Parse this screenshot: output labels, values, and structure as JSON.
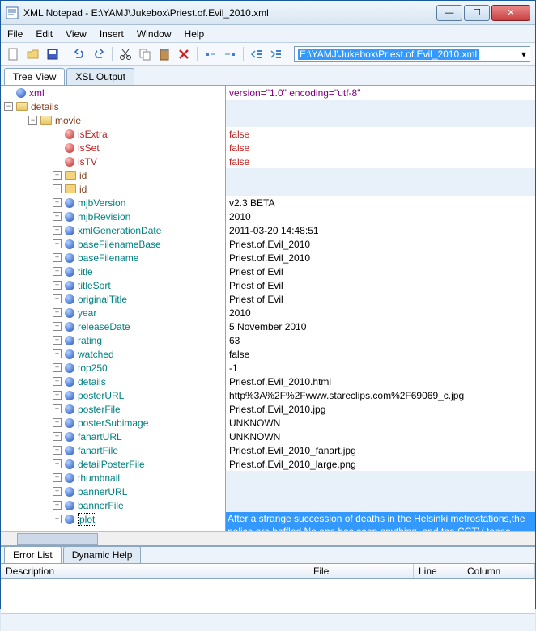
{
  "window": {
    "title": "XML Notepad - E:\\YAMJ\\Jukebox\\Priest.of.Evil_2010.xml"
  },
  "menu": {
    "file": "File",
    "edit": "Edit",
    "view": "View",
    "insert": "Insert",
    "window": "Window",
    "help": "Help"
  },
  "address": {
    "path": "E:\\YAMJ\\Jukebox\\Priest.of.Evil_2010.xml"
  },
  "tabs": {
    "tree": "Tree View",
    "xsl": "XSL Output"
  },
  "tree": {
    "xml": "xml",
    "details": "details",
    "movie": "movie",
    "nodes": {
      "isExtra": "isExtra",
      "isSet": "isSet",
      "isTV": "isTV",
      "id1": "id",
      "id2": "id",
      "mjbVersion": "mjbVersion",
      "mjbRevision": "mjbRevision",
      "xmlGenerationDate": "xmlGenerationDate",
      "baseFilenameBase": "baseFilenameBase",
      "baseFilename": "baseFilename",
      "title": "title",
      "titleSort": "titleSort",
      "originalTitle": "originalTitle",
      "year": "year",
      "releaseDate": "releaseDate",
      "rating": "rating",
      "watched": "watched",
      "top250": "top250",
      "details": "details",
      "posterURL": "posterURL",
      "posterFile": "posterFile",
      "posterSubimage": "posterSubimage",
      "fanartURL": "fanartURL",
      "fanartFile": "fanartFile",
      "detailPosterFile": "detailPosterFile",
      "thumbnail": "thumbnail",
      "bannerURL": "bannerURL",
      "bannerFile": "bannerFile",
      "plot": "plot"
    }
  },
  "values": {
    "xml": "version=\"1.0\" encoding=\"utf-8\"",
    "isExtra": "false",
    "isSet": "false",
    "isTV": "false",
    "mjbVersion": "v2.3 BETA",
    "mjbRevision": "2010",
    "xmlGenerationDate": "2011-03-20 14:48:51",
    "baseFilenameBase": "Priest.of.Evil_2010",
    "baseFilename": "Priest.of.Evil_2010",
    "title": "Priest of Evil",
    "titleSort": "Priest of Evil",
    "originalTitle": "Priest of Evil",
    "year": "2010",
    "releaseDate": "5 November 2010",
    "rating": "63",
    "watched": "false",
    "top250": "-1",
    "details": "Priest.of.Evil_2010.html",
    "posterURL": "http%3A%2F%2Fwww.stareclips.com%2F69069_c.jpg",
    "posterFile": "Priest.of.Evil_2010.jpg",
    "posterSubimage": "UNKNOWN",
    "fanartURL": "UNKNOWN",
    "fanartFile": "Priest.of.Evil_2010_fanart.jpg",
    "detailPosterFile": "Priest.of.Evil_2010_large.png",
    "plot": "After a strange succession of deaths in the Helsinki metrostations,the police are baffled.No one has seen anything, and the CCTV tapes show nothing. Audio Finnish with English Subtitles."
  },
  "bottomTabs": {
    "errors": "Error List",
    "help": "Dynamic Help"
  },
  "grid": {
    "desc": "Description",
    "file": "File",
    "line": "Line",
    "col": "Column"
  }
}
